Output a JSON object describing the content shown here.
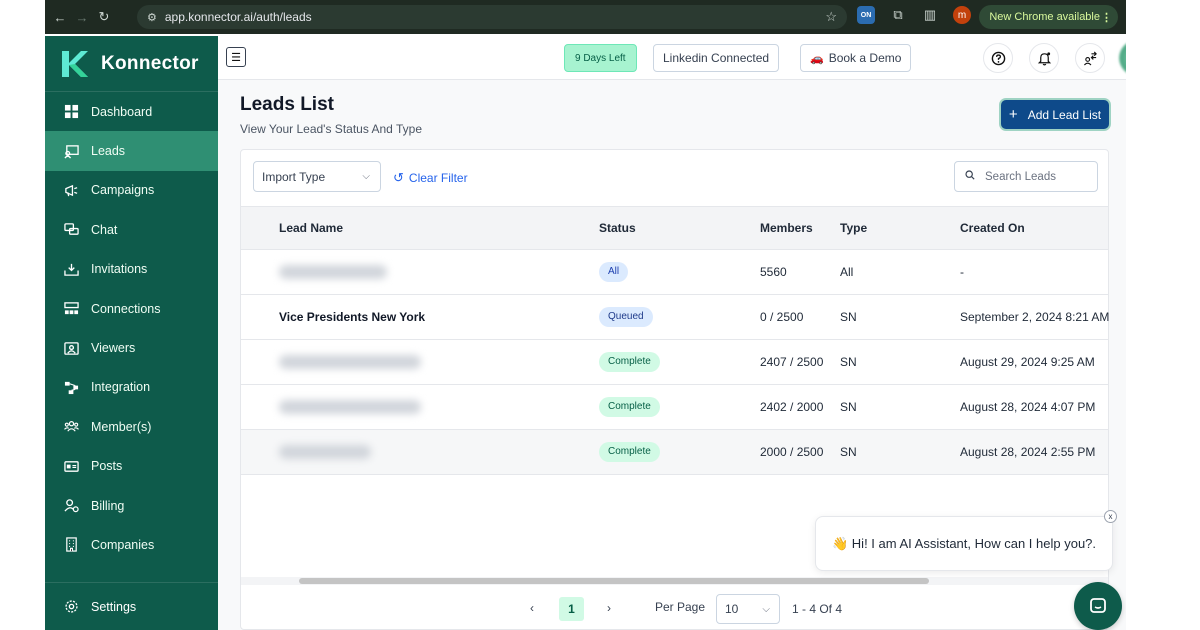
{
  "browser": {
    "url": "app.konnector.ai/auth/leads",
    "update_label": "New Chrome available",
    "ext_badge": "ON",
    "profile_initial": "m"
  },
  "sidebar": {
    "brand": "Konnector",
    "items": [
      {
        "label": "Dashboard",
        "icon": "dashboard-icon",
        "active": false
      },
      {
        "label": "Leads",
        "icon": "leads-icon",
        "active": true
      },
      {
        "label": "Campaigns",
        "icon": "megaphone-icon",
        "active": false
      },
      {
        "label": "Chat",
        "icon": "chat-icon",
        "active": false
      },
      {
        "label": "Invitations",
        "icon": "inbox-icon",
        "active": false
      },
      {
        "label": "Connections",
        "icon": "connections-icon",
        "active": false
      },
      {
        "label": "Viewers",
        "icon": "viewers-icon",
        "active": false
      },
      {
        "label": "Integration",
        "icon": "integration-icon",
        "active": false
      },
      {
        "label": "Member(s)",
        "icon": "members-icon",
        "active": false
      },
      {
        "label": "Posts",
        "icon": "posts-icon",
        "active": false
      },
      {
        "label": "Billing",
        "icon": "billing-icon",
        "active": false
      },
      {
        "label": "Companies",
        "icon": "companies-icon",
        "active": false
      }
    ],
    "settings_label": "Settings"
  },
  "header": {
    "days_left": "9 Days Left",
    "linkedin": "Linkedin Connected",
    "demo": "Book a Demo"
  },
  "page": {
    "title": "Leads List",
    "subtitle": "View Your Lead's Status And Type",
    "add_button": "Add Lead List"
  },
  "filters": {
    "import_type": "Import Type",
    "clear": "Clear Filter",
    "search_placeholder": "Search Leads"
  },
  "table": {
    "headers": [
      "Lead Name",
      "Status",
      "Members",
      "Type",
      "Created On"
    ],
    "rows": [
      {
        "name": "",
        "blurred": true,
        "status": "All",
        "members": "5560",
        "type": "All",
        "created": "-"
      },
      {
        "name": "Vice Presidents New York",
        "blurred": false,
        "status": "Queued",
        "members": "0 / 2500",
        "type": "SN",
        "created": "September 2, 2024 8:21 AM"
      },
      {
        "name": "",
        "blurred": true,
        "status": "Complete",
        "members": "2407 / 2500",
        "type": "SN",
        "created": "August 29, 2024 9:25 AM"
      },
      {
        "name": "",
        "blurred": true,
        "status": "Complete",
        "members": "2402 / 2000",
        "type": "SN",
        "created": "August 28, 2024 4:07 PM"
      },
      {
        "name": "",
        "blurred": true,
        "status": "Complete",
        "members": "2000 / 2500",
        "type": "SN",
        "created": "August 28, 2024 2:55 PM"
      }
    ]
  },
  "pagination": {
    "prev": "‹",
    "current": "1",
    "next": "›",
    "per_page_label": "Per Page",
    "per_page_value": "10",
    "range": "1 - 4 Of 4"
  },
  "chat": {
    "message": "👋 Hi! I am AI Assistant, How can I help you?.",
    "close": "x"
  },
  "colors": {
    "sidebar": "#0e5b4b",
    "sidebar_active": "#2f8f73",
    "primary_button": "#0e4a8a",
    "link": "#2563eb"
  }
}
